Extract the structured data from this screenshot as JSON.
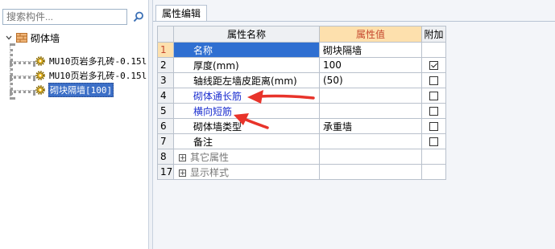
{
  "search": {
    "placeholder": "搜索构件..."
  },
  "tree": {
    "root": {
      "label": "砌体墙",
      "icon": "brick-wall-icon"
    },
    "items": [
      {
        "label": "MU10页岩多孔砖-0.15l",
        "icon": "gear-icon",
        "selected": false
      },
      {
        "label": "MU10页岩多孔砖-0.15l",
        "icon": "gear-icon",
        "selected": false
      },
      {
        "label": "砌块隔墙[100]",
        "icon": "gear-icon",
        "selected": true
      }
    ]
  },
  "panel": {
    "tab_label": "属性编辑"
  },
  "grid": {
    "headers": {
      "name": "属性名称",
      "value": "属性值",
      "extra": "附加"
    },
    "rows": [
      {
        "num": "1",
        "name": "名称",
        "value": "砌块隔墙",
        "checkbox": null,
        "style": "normal",
        "selected": true
      },
      {
        "num": "2",
        "name": "厚度(mm)",
        "value": "100",
        "checkbox": true,
        "style": "normal",
        "selected": false
      },
      {
        "num": "3",
        "name": "轴线距左墙皮距离(mm)",
        "value": "(50)",
        "checkbox": false,
        "style": "normal",
        "selected": false
      },
      {
        "num": "4",
        "name": "砌体通长筋",
        "value": "",
        "checkbox": false,
        "style": "link",
        "selected": false
      },
      {
        "num": "5",
        "name": "横向短筋",
        "value": "",
        "checkbox": false,
        "style": "link",
        "selected": false
      },
      {
        "num": "6",
        "name": "砌体墙类型",
        "value": "承重墙",
        "checkbox": false,
        "style": "normal",
        "selected": false
      },
      {
        "num": "7",
        "name": "备注",
        "value": "",
        "checkbox": false,
        "style": "normal",
        "selected": false
      },
      {
        "num": "8",
        "name": "其它属性",
        "value": "",
        "checkbox": null,
        "style": "group",
        "selected": false
      },
      {
        "num": "17",
        "name": "显示样式",
        "value": "",
        "checkbox": null,
        "style": "group",
        "selected": false
      }
    ]
  },
  "colors": {
    "selection": "#2f6fd1",
    "header_highlight": "#fde0ad",
    "link": "#1b2ecf",
    "arrow": "#e8332a"
  }
}
